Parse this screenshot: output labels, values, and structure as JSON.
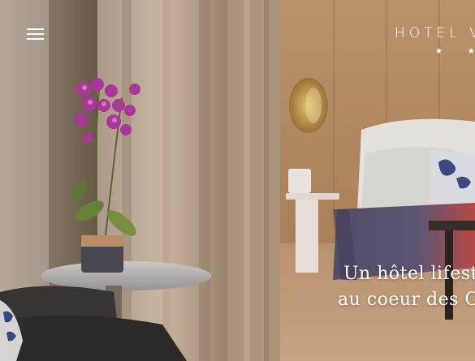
{
  "header": {
    "menu_icon": "hamburger-menu-icon",
    "brand_name": "HOTEL V",
    "brand_stars": "★ ★ ★"
  },
  "hero": {
    "tagline_line1": "Un hôtel lifesty",
    "tagline_line2": "au coeur des Cl",
    "image": "hotel-room-photo"
  },
  "colors": {
    "text": "#ffffff",
    "wood": "#c9a27a",
    "bedspread": "#5a5474",
    "orchid": "#b63aa6"
  }
}
